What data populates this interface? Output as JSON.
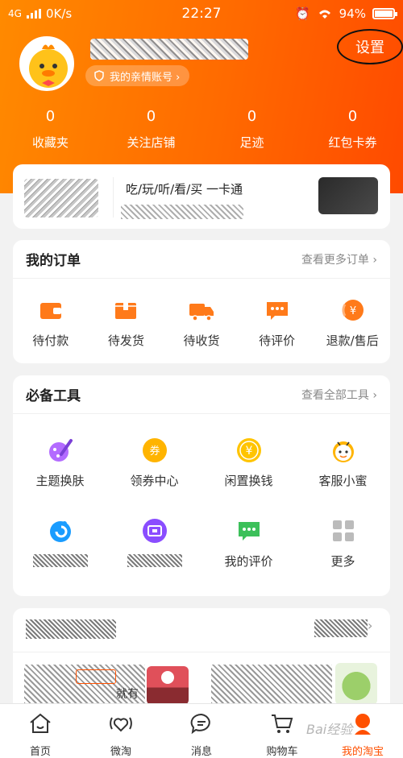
{
  "status_bar": {
    "network": "4G",
    "speed": "0K/s",
    "time": "22:27",
    "battery": "94%"
  },
  "profile": {
    "family_account_label": "我的亲情账号 ›",
    "settings_label": "设置"
  },
  "stats": [
    {
      "count": "0",
      "label": "收藏夹"
    },
    {
      "count": "0",
      "label": "关注店铺"
    },
    {
      "count": "0",
      "label": "足迹"
    },
    {
      "count": "0",
      "label": "红包卡券"
    }
  ],
  "promo": {
    "title": "吃/玩/听/看/买 一卡通"
  },
  "orders": {
    "title": "我的订单",
    "more": "查看更多订单 ›",
    "items": [
      {
        "label": "待付款",
        "icon": "wallet-icon"
      },
      {
        "label": "待发货",
        "icon": "package-icon"
      },
      {
        "label": "待收货",
        "icon": "truck-icon"
      },
      {
        "label": "待评价",
        "icon": "comment-icon"
      },
      {
        "label": "退款/售后",
        "icon": "refund-icon"
      }
    ]
  },
  "tools": {
    "title": "必备工具",
    "more": "查看全部工具 ›",
    "items": [
      {
        "label": "主题换肤",
        "icon": "theme-brush-icon"
      },
      {
        "label": "领券中心",
        "icon": "coupon-icon"
      },
      {
        "label": "闲置换钱",
        "icon": "yuan-coin-icon"
      },
      {
        "label": "客服小蜜",
        "icon": "service-bee-icon"
      },
      {
        "label": "",
        "icon": "blue-swirl-icon"
      },
      {
        "label": "",
        "icon": "purple-card-icon"
      },
      {
        "label": "我的评价",
        "icon": "review-icon"
      },
      {
        "label": "更多",
        "icon": "grid-more-icon"
      }
    ]
  },
  "feed": {
    "snippet": "就有"
  },
  "tabbar": [
    {
      "label": "首页",
      "icon": "home-icon"
    },
    {
      "label": "微淘",
      "icon": "heart-signal-icon"
    },
    {
      "label": "消息",
      "icon": "chat-icon"
    },
    {
      "label": "购物车",
      "icon": "cart-icon"
    },
    {
      "label": "我的淘宝",
      "icon": "profile-icon"
    }
  ],
  "watermark": "Bai经验",
  "colors": {
    "brand_orange": "#ff5000",
    "header_gradient_start": "#ff8a00",
    "header_gradient_end": "#ff4a00"
  }
}
